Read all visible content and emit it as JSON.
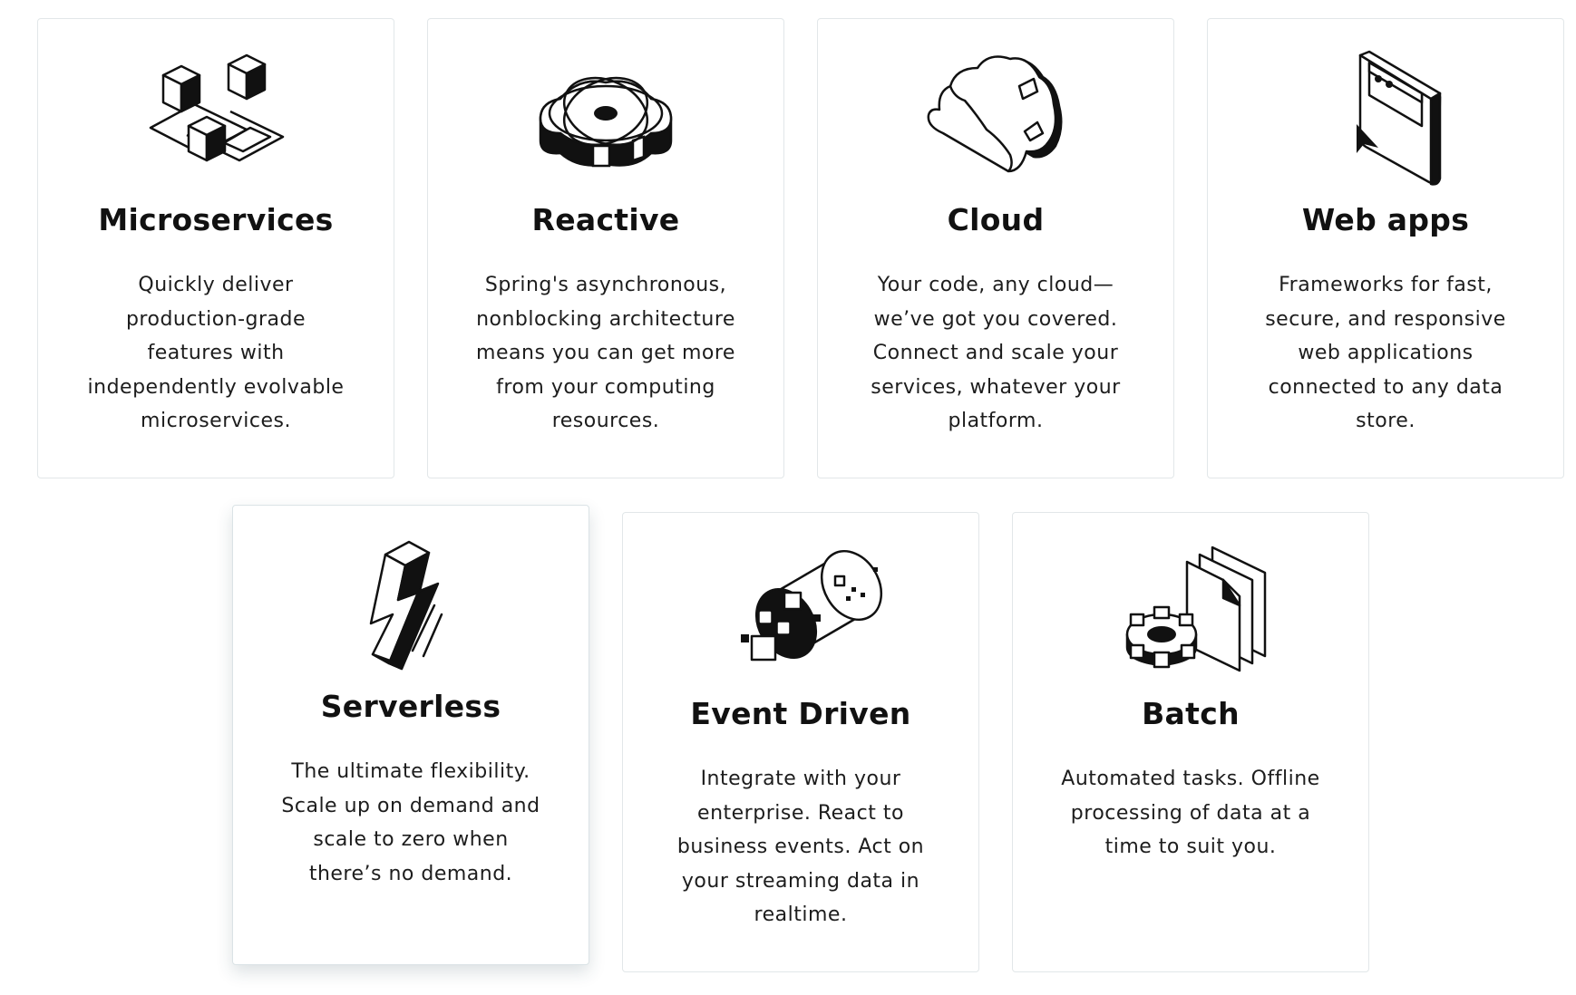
{
  "colors": {
    "ink": "#111111",
    "card_border": "#e2e7e9",
    "background": "#ffffff"
  },
  "cards": [
    {
      "icon": "microservices-cubes-icon",
      "title": "Microservices",
      "description": "Quickly deliver production-grade features with independently evolvable microservices."
    },
    {
      "icon": "reactive-orbit-icon",
      "title": "Reactive",
      "description": "Spring's asynchronous, nonblocking architecture means you can get more from your computing resources."
    },
    {
      "icon": "cloud-icon",
      "title": "Cloud",
      "description": "Your code, any cloud—we’ve got you covered. Connect and scale your services, whatever your platform."
    },
    {
      "icon": "browser-window-icon",
      "title": "Web apps",
      "description": "Frameworks for fast, secure, and responsive web applications connected to any data store."
    },
    {
      "icon": "lightning-bolt-icon",
      "title": "Serverless",
      "description": "The ultimate flexibility. Scale up on demand and scale to zero when there’s no demand."
    },
    {
      "icon": "event-stream-cylinder-icon",
      "title": "Event Driven",
      "description": "Integrate with your enterprise. React to business events. Act on your streaming data in realtime."
    },
    {
      "icon": "gear-documents-icon",
      "title": "Batch",
      "description": "Automated tasks. Offline processing of data at a time to suit you."
    }
  ]
}
